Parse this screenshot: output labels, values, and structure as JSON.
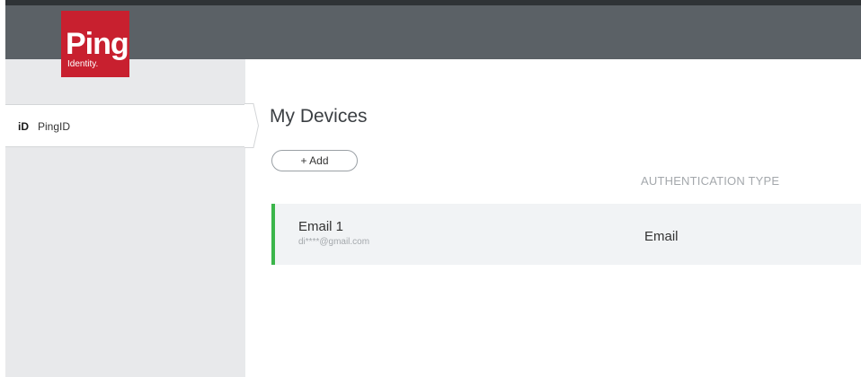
{
  "brand": {
    "logo_text": "Ping",
    "logo_subtext": "Identity.",
    "accent_color": "#c8202f"
  },
  "sidebar": {
    "items": [
      {
        "icon": "iD",
        "label": "PingID",
        "selected": true
      }
    ]
  },
  "main": {
    "title": "My Devices",
    "add_button_label": "+ Add",
    "columns": [
      "AUTHENTICATION TYPE"
    ],
    "devices": [
      {
        "name": "Email 1",
        "detail": "di****@gmail.com",
        "type": "Email",
        "status_color": "#3bb54a"
      }
    ]
  }
}
